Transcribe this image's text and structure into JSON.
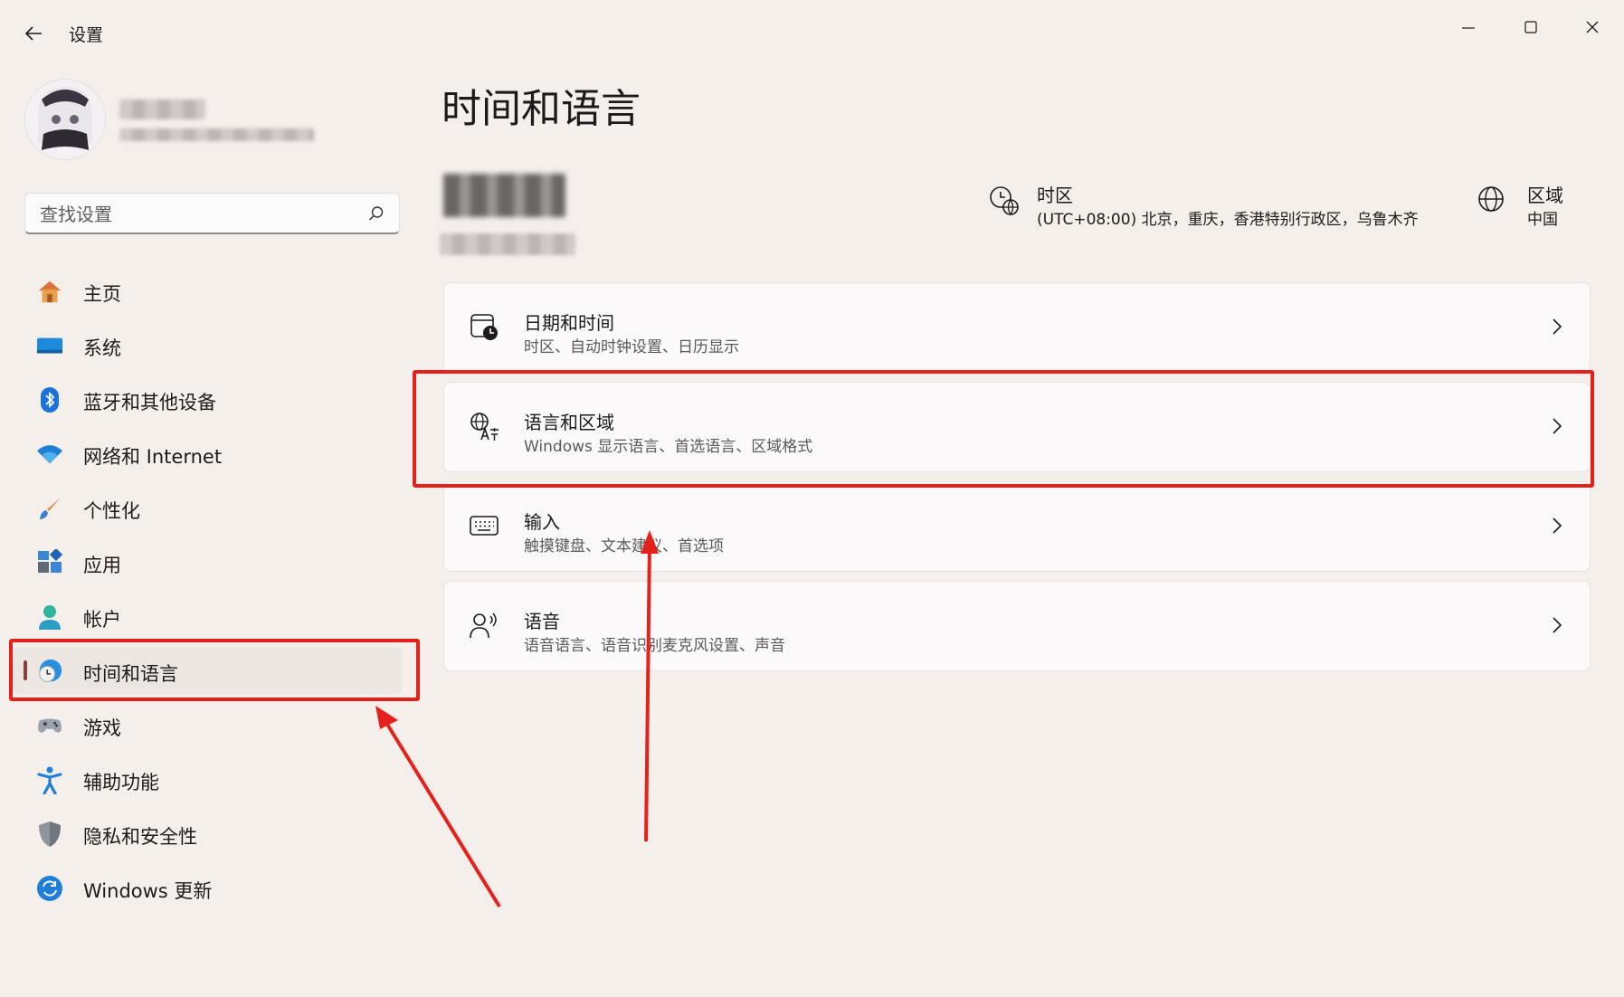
{
  "titlebar": {
    "app_title": "设置",
    "minimize_icon": "minimize-icon",
    "maximize_icon": "maximize-icon",
    "close_icon": "close-icon"
  },
  "search": {
    "placeholder": "查找设置",
    "value": ""
  },
  "sidebar": {
    "items": [
      {
        "label": "主页",
        "icon": "home-icon"
      },
      {
        "label": "系统",
        "icon": "system-icon"
      },
      {
        "label": "蓝牙和其他设备",
        "icon": "bluetooth-icon"
      },
      {
        "label": "网络和 Internet",
        "icon": "wifi-icon"
      },
      {
        "label": "个性化",
        "icon": "brush-icon"
      },
      {
        "label": "应用",
        "icon": "apps-icon"
      },
      {
        "label": "帐户",
        "icon": "account-icon"
      },
      {
        "label": "时间和语言",
        "icon": "time-language-icon",
        "selected": true
      },
      {
        "label": "游戏",
        "icon": "gamepad-icon"
      },
      {
        "label": "辅助功能",
        "icon": "accessibility-icon"
      },
      {
        "label": "隐私和安全性",
        "icon": "shield-icon"
      },
      {
        "label": "Windows 更新",
        "icon": "update-icon"
      }
    ]
  },
  "main": {
    "title": "时间和语言",
    "timezone": {
      "label": "时区",
      "value": "(UTC+08:00) 北京，重庆，香港特别行政区，乌鲁木齐"
    },
    "region": {
      "label": "区域",
      "value": "中国"
    },
    "cards": [
      {
        "title": "日期和时间",
        "desc": "时区、自动时钟设置、日历显示",
        "icon": "calendar-clock-icon"
      },
      {
        "title": "语言和区域",
        "desc": "Windows 显示语言、首选语言、区域格式",
        "icon": "language-icon"
      },
      {
        "title": "输入",
        "desc": "触摸键盘、文本建议、首选项",
        "icon": "keyboard-icon"
      },
      {
        "title": "语音",
        "desc": "语音语言、语音识别麦克风设置、声音",
        "icon": "speech-icon"
      }
    ]
  },
  "colors": {
    "background": "#f5efec",
    "annotation": "#e5211b",
    "accent_indicator": "#8a3b3b"
  }
}
